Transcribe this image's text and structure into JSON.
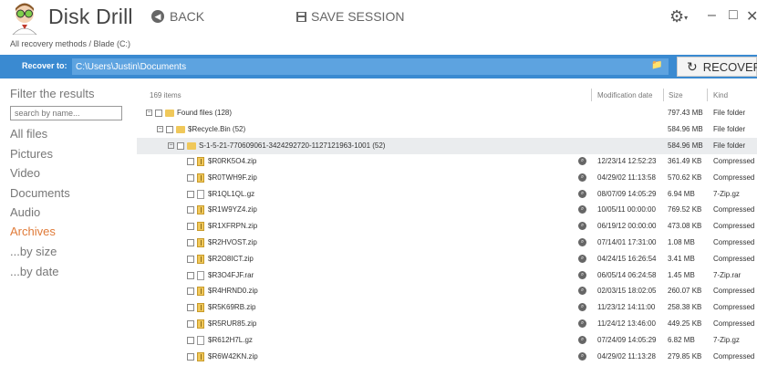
{
  "header": {
    "app_title": "Disk Drill",
    "back_label": "BACK",
    "save_session_label": "SAVE SESSION"
  },
  "breadcrumb": "All recovery methods / Blade (C:)",
  "recover_bar": {
    "label": "Recover to:",
    "path": "C:\\Users\\Justin\\Documents",
    "button_label": "RECOVER"
  },
  "sidebar": {
    "title": "Filter the results",
    "search_placeholder": "search by name...",
    "items": [
      {
        "label": "All files",
        "active": false
      },
      {
        "label": "Pictures",
        "active": false
      },
      {
        "label": "Video",
        "active": false
      },
      {
        "label": "Documents",
        "active": false
      },
      {
        "label": "Audio",
        "active": false
      },
      {
        "label": "Archives",
        "active": true
      },
      {
        "label": "...by size",
        "active": false
      },
      {
        "label": "...by date",
        "active": false
      }
    ]
  },
  "list": {
    "items_count": "169 items",
    "columns": {
      "modified": "Modification date",
      "size": "Size",
      "kind": "Kind"
    },
    "folders": [
      {
        "name": "Found files (128)",
        "size": "797.43 MB",
        "kind": "File folder"
      },
      {
        "name": "$Recycle.Bin (52)",
        "size": "584.96 MB",
        "kind": "File folder"
      },
      {
        "name": "S-1-5-21-770609061-3424292720-1127121963-1001 (52)",
        "size": "584.96 MB",
        "kind": "File folder"
      }
    ],
    "files": [
      {
        "name": "$R0RK5O4.zip",
        "date": "12/23/14 12:52:23",
        "size": "361.49 KB",
        "kind": "Compressed",
        "type": "zip"
      },
      {
        "name": "$R0TWH9F.zip",
        "date": "04/29/02 11:13:58",
        "size": "570.62 KB",
        "kind": "Compressed",
        "type": "zip"
      },
      {
        "name": "$R1QL1QL.gz",
        "date": "08/07/09 14:05:29",
        "size": "6.94 MB",
        "kind": "7-Zip.gz",
        "type": "file"
      },
      {
        "name": "$R1W9YZ4.zip",
        "date": "10/05/11 00:00:00",
        "size": "769.52 KB",
        "kind": "Compressed",
        "type": "zip"
      },
      {
        "name": "$R1XFRPN.zip",
        "date": "06/19/12 00:00:00",
        "size": "473.08 KB",
        "kind": "Compressed",
        "type": "zip"
      },
      {
        "name": "$R2HVOST.zip",
        "date": "07/14/01 17:31:00",
        "size": "1.08 MB",
        "kind": "Compressed",
        "type": "zip"
      },
      {
        "name": "$R2O8ICT.zip",
        "date": "04/24/15 16:26:54",
        "size": "3.41 MB",
        "kind": "Compressed",
        "type": "zip"
      },
      {
        "name": "$R3O4FJF.rar",
        "date": "06/05/14 06:24:58",
        "size": "1.45 MB",
        "kind": "7-Zip.rar",
        "type": "file"
      },
      {
        "name": "$R4HRND0.zip",
        "date": "02/03/15 18:02:05",
        "size": "260.07 KB",
        "kind": "Compressed",
        "type": "zip"
      },
      {
        "name": "$R5K69RB.zip",
        "date": "11/23/12 14:11:00",
        "size": "258.38 KB",
        "kind": "Compressed",
        "type": "zip"
      },
      {
        "name": "$R5RUR85.zip",
        "date": "11/24/12 13:46:00",
        "size": "449.25 KB",
        "kind": "Compressed",
        "type": "zip"
      },
      {
        "name": "$R612H7L.gz",
        "date": "07/24/09 14:05:29",
        "size": "6.82 MB",
        "kind": "7-Zip.gz",
        "type": "file"
      },
      {
        "name": "$R6W42KN.zip",
        "date": "04/29/02 11:13:28",
        "size": "279.85 KB",
        "kind": "Compressed",
        "type": "zip"
      }
    ]
  }
}
